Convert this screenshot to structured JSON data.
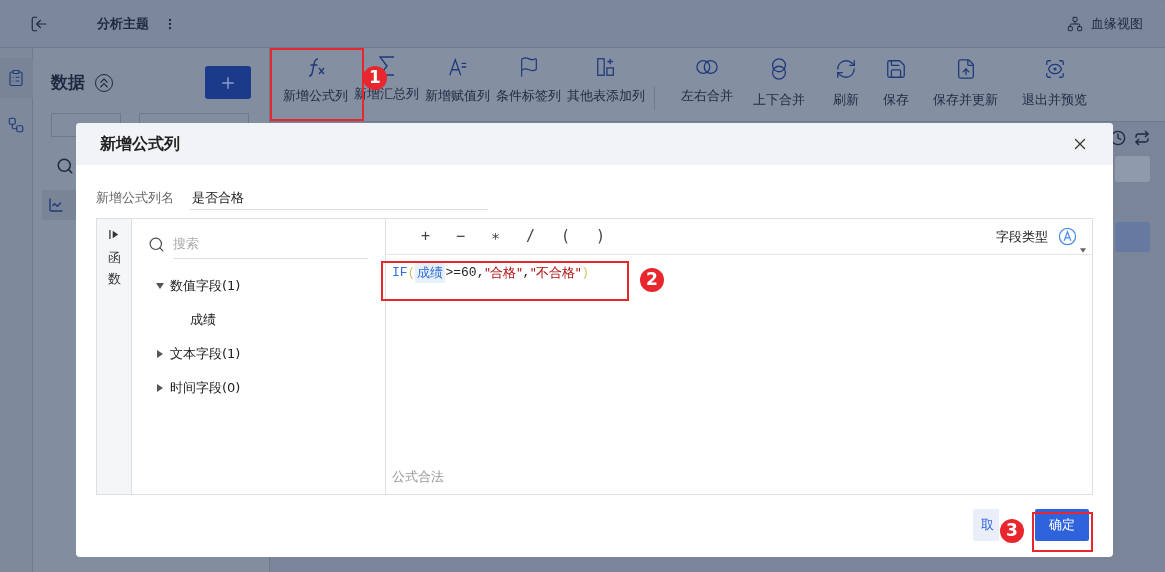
{
  "topbar": {
    "title": "分析主题",
    "lineage": "血缘视图"
  },
  "data_panel": {
    "title": "数据"
  },
  "toolbar": {
    "groups": [
      [
        {
          "label": "新增公式列",
          "kind": "formula"
        },
        {
          "label": "新增汇总列",
          "kind": "sum"
        },
        {
          "label": "新增赋值列",
          "kind": "assign"
        },
        {
          "label": "条件标签列",
          "kind": "flag"
        },
        {
          "label": "其他表添加列",
          "kind": "addcol"
        }
      ],
      [
        {
          "label": "左右合并",
          "kind": "joinh"
        },
        {
          "label": "上下合并",
          "kind": "joinv"
        }
      ],
      [
        {
          "label": "刷新",
          "kind": "refresh"
        },
        {
          "label": "保存",
          "kind": "save"
        },
        {
          "label": "保存并更新",
          "kind": "saveupdate"
        },
        {
          "label": "退出并预览",
          "kind": "preview"
        }
      ]
    ]
  },
  "dialog": {
    "title": "新增公式列",
    "name_label": "新增公式列名",
    "name_value": "是否合格",
    "side_tab": "函数",
    "search": {
      "placeholder": "搜索"
    },
    "tree": [
      {
        "label": "数值字段(1)",
        "expanded": true,
        "children": [
          {
            "label": "成绩"
          }
        ]
      },
      {
        "label": "文本字段(1)",
        "expanded": false
      },
      {
        "label": "时间字段(0)",
        "expanded": false
      }
    ],
    "operators": [
      "+",
      "−",
      "∗",
      "/",
      "(",
      ")"
    ],
    "field_type_label": "字段类型",
    "formula": [
      {
        "kind": "func",
        "text": "IF"
      },
      {
        "kind": "paren",
        "text": "("
      },
      {
        "kind": "field",
        "text": "成绩"
      },
      {
        "kind": "plain",
        "text": ">=60,"
      },
      {
        "kind": "string",
        "text": "\"合格\""
      },
      {
        "kind": "plain",
        "text": ","
      },
      {
        "kind": "string",
        "text": "\"不合格\""
      },
      {
        "kind": "paren",
        "text": ")"
      }
    ],
    "status": "公式合法",
    "buttons": [
      {
        "label": "取",
        "kind": "cancel"
      },
      {
        "label": "确定",
        "kind": "primary"
      }
    ]
  },
  "steps": [
    "1",
    "2",
    "3"
  ]
}
